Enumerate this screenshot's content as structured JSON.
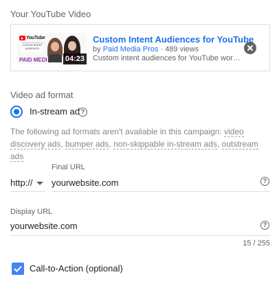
{
  "section_title": "Your YouTube Video",
  "video": {
    "thumbnail": {
      "logo_text": "YouTube",
      "banner_text": "CUSTOM INTENT AUDIENCES",
      "brand_text": "PAID MEDI",
      "duration": "04:23"
    },
    "title": "Custom Intent Audiences for YouTube",
    "by_prefix": "by",
    "channel": "Paid Media Pros",
    "views": "· 489 views",
    "description": "Custom intent audiences for YouTube work..."
  },
  "ad_format": {
    "label": "Video ad format",
    "option": "In-stream ad",
    "selected": true,
    "notice_prefix": "The following ad formats aren't available in this campaign:",
    "unavailable": [
      "video discovery ads",
      "bumper ads",
      "non-skippable in-stream ads",
      "outstream ads"
    ]
  },
  "final_url": {
    "label": "Final URL",
    "protocol": "http://",
    "value": "yourwebsite.com"
  },
  "display_url": {
    "label": "Display URL",
    "value": "yourwebsite.com",
    "counter": "15 / 255"
  },
  "cta": {
    "label": "Call-to-Action (optional)",
    "checked": true
  },
  "colors": {
    "accent": "#1a73e8",
    "checkbox": "#4285f4",
    "muted": "#80868b"
  }
}
